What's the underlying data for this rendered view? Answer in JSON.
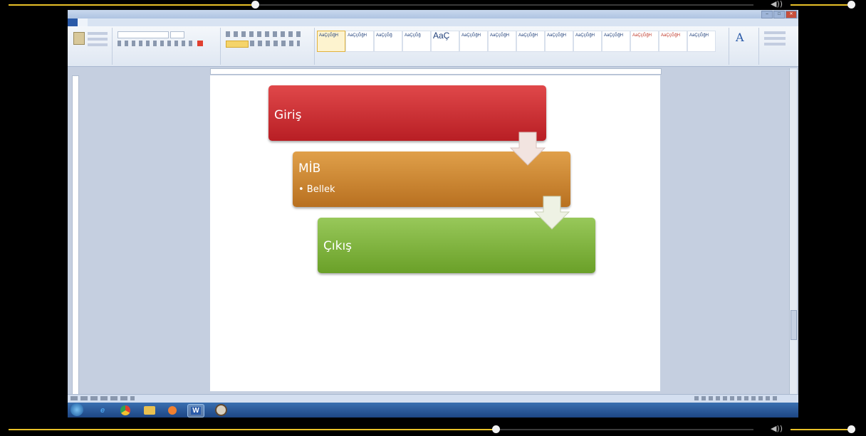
{
  "player": {
    "top_progress": 0.295,
    "bottom_progress": 0.57,
    "volume_icon": "speaker-icon",
    "volume_level": 0.85
  },
  "window": {
    "title": "",
    "quick_access": "",
    "buttons": [
      "–",
      "□",
      "✕"
    ]
  },
  "ribbon": {
    "tabs": [
      {
        "label": "",
        "kind": "file"
      },
      {
        "label": "",
        "kind": "active"
      },
      {
        "label": ""
      },
      {
        "label": ""
      },
      {
        "label": ""
      },
      {
        "label": ""
      },
      {
        "label": ""
      },
      {
        "label": ""
      }
    ],
    "styles": [
      "AaÇçĞğH",
      "AaÇçĞğH",
      "AaÇçĞğ",
      "AaÇçĞğ",
      "AaÇ",
      "AaÇçĞğH",
      "AaÇçĞğH",
      "AaÇçĞğH",
      "AaÇçĞğH",
      "AaÇçĞğH",
      "AaÇçĞğH",
      "AaÇçĞğH",
      "AaÇçĞğH",
      "AaÇçĞğH"
    ]
  },
  "smartart": {
    "box1": {
      "title": "Giriş",
      "color": "#c8262a"
    },
    "box2": {
      "title": "MİB",
      "bullet": "• Bellek",
      "color": "#c88428"
    },
    "box3": {
      "title": "Çıkış",
      "color": "#7ab030"
    }
  },
  "taskbar": {
    "icons": [
      "start-orb-icon",
      "ie-icon",
      "chrome-icon",
      "folder-icon",
      "media-player-icon",
      "word-icon",
      "paint-icon"
    ],
    "word_label": "W",
    "clock": ""
  }
}
